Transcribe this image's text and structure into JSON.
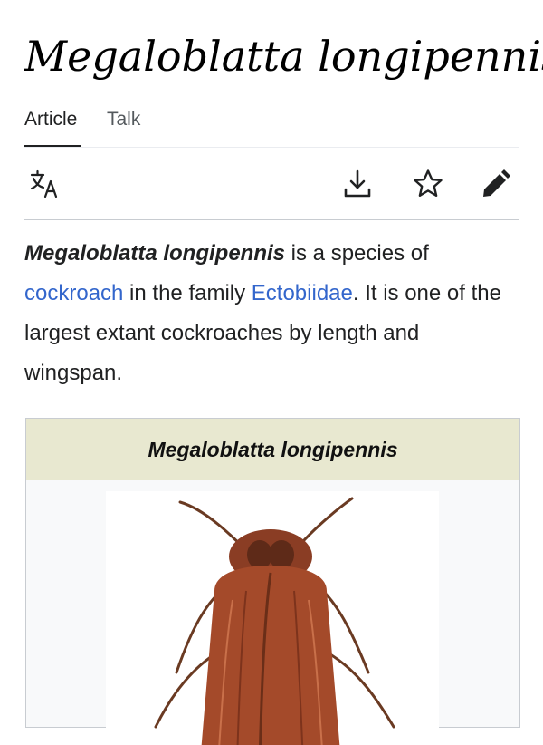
{
  "article": {
    "title": "Megaloblatta longipennis"
  },
  "tabs": [
    {
      "label": "Article",
      "active": true
    },
    {
      "label": "Talk",
      "active": false
    }
  ],
  "toolbar": {
    "icons": [
      "language-icon",
      "download-icon",
      "star-icon",
      "edit-pencil-icon"
    ]
  },
  "lead": {
    "subject": "Megaloblatta longipennis",
    "text_1": " is a species of ",
    "link_1": "cockroach",
    "text_2": " in the family ",
    "link_2": "Ectobiidae",
    "text_3": ". It is one of the largest extant cockroaches by length and wingspan."
  },
  "infobox": {
    "caption": "Megaloblatta longipennis",
    "image_icon": "cockroach-illustration"
  },
  "colors": {
    "link": "#3366cc",
    "infobox_header": "#e8e8d0",
    "insect_body": "#a44a2a"
  }
}
